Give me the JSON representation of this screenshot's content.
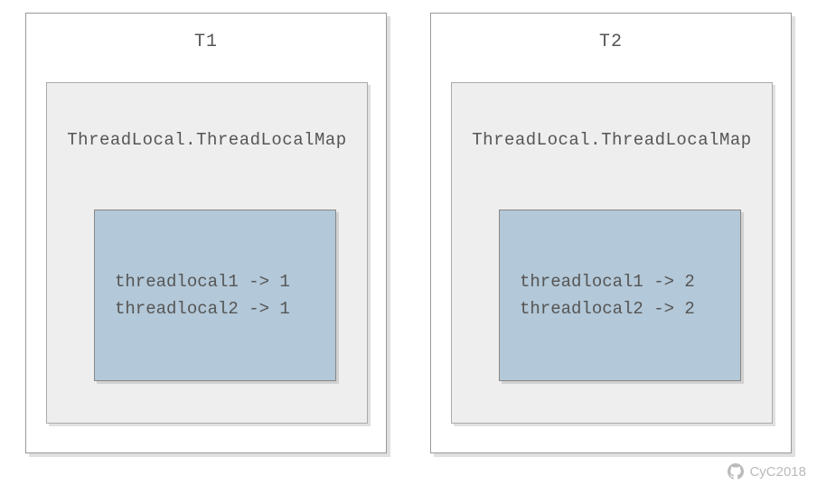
{
  "threads": [
    {
      "title": "T1",
      "map_label": "ThreadLocal.ThreadLocalMap",
      "entries": [
        "threadlocal1 -> 1",
        "threadlocal2 -> 1"
      ]
    },
    {
      "title": "T2",
      "map_label": "ThreadLocal.ThreadLocalMap",
      "entries": [
        "threadlocal1 -> 2",
        "threadlocal2 -> 2"
      ]
    }
  ],
  "watermark": "CyC2018",
  "chart_data": {
    "type": "diagram",
    "description": "Two thread boxes T1 and T2 each containing a ThreadLocal.ThreadLocalMap with two threadlocal key-value entries",
    "threads": [
      {
        "name": "T1",
        "map": {
          "threadlocal1": 1,
          "threadlocal2": 1
        }
      },
      {
        "name": "T2",
        "map": {
          "threadlocal1": 2,
          "threadlocal2": 2
        }
      }
    ]
  }
}
